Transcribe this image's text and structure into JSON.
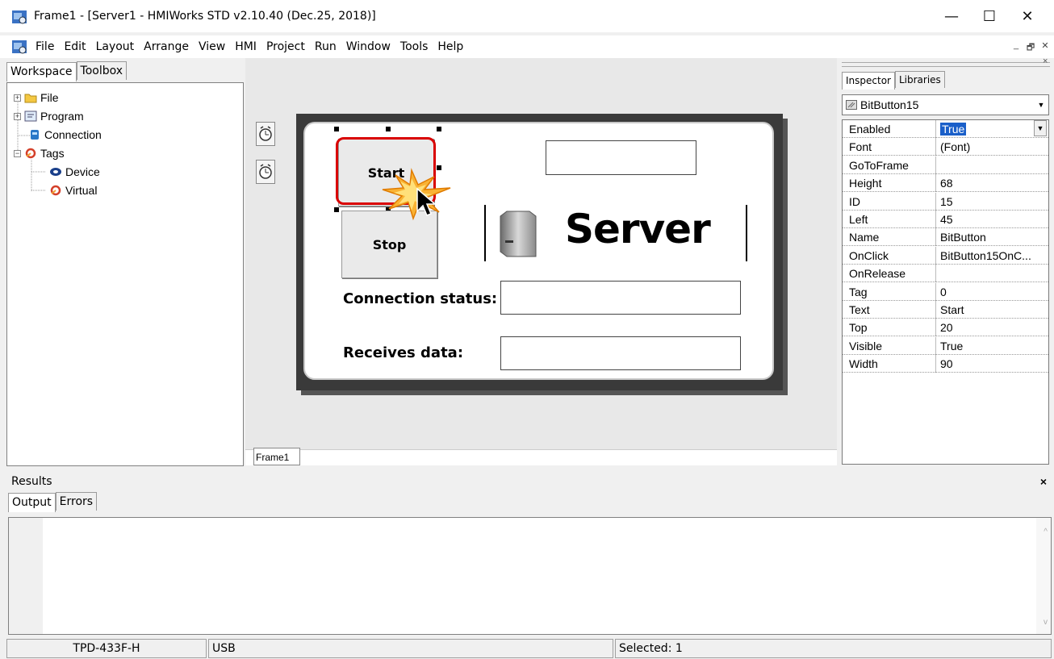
{
  "window": {
    "title": "Frame1 - [Server1 - HMIWorks STD v2.10.40 (Dec.25, 2018)]",
    "controls": {
      "minimize": "—",
      "maximize": "☐",
      "close": "✕"
    }
  },
  "menu": [
    "File",
    "Edit",
    "Layout",
    "Arrange",
    "View",
    "HMI",
    "Project",
    "Run",
    "Window",
    "Tools",
    "Help"
  ],
  "mdi_controls": [
    "_",
    "🗗",
    "✕"
  ],
  "workspace": {
    "tabs": [
      "Workspace",
      "Toolbox"
    ],
    "tree": [
      {
        "label": "File",
        "expander": "+",
        "icon": "folder-icon"
      },
      {
        "label": "Program",
        "expander": "+",
        "icon": "program-icon"
      },
      {
        "label": "Connection",
        "expander": "",
        "icon": "connection-icon"
      },
      {
        "label": "Tags",
        "expander": "−",
        "icon": "tags-icon"
      },
      {
        "label": "Device",
        "expander": "",
        "icon": "device-icon"
      },
      {
        "label": "Virtual",
        "expander": "",
        "icon": "virtual-icon"
      }
    ]
  },
  "design": {
    "frame_tab": "Frame1",
    "start_label": "Start",
    "stop_label": "Stop",
    "server_label": "Server",
    "conn_status_label": "Connection status:",
    "receives_label": "Receives data:"
  },
  "inspector": {
    "tabs": [
      "Inspector",
      "Libraries"
    ],
    "selected_object": "BitButton15",
    "properties": [
      {
        "name": "Enabled",
        "value": "True"
      },
      {
        "name": "Font",
        "value": "(Font)"
      },
      {
        "name": "GoToFrame",
        "value": ""
      },
      {
        "name": "Height",
        "value": "68"
      },
      {
        "name": "ID",
        "value": "15"
      },
      {
        "name": "Left",
        "value": "45"
      },
      {
        "name": "Name",
        "value": "BitButton"
      },
      {
        "name": "OnClick",
        "value": "BitButton15OnC..."
      },
      {
        "name": "OnRelease",
        "value": ""
      },
      {
        "name": "Tag",
        "value": "0"
      },
      {
        "name": "Text",
        "value": "Start"
      },
      {
        "name": "Top",
        "value": "20"
      },
      {
        "name": "Visible",
        "value": "True"
      },
      {
        "name": "Width",
        "value": "90"
      }
    ]
  },
  "results": {
    "title": "Results",
    "close": "×",
    "tabs": [
      "Output",
      "Errors"
    ]
  },
  "status": {
    "device": "TPD-433F-H",
    "port": "USB",
    "selected": "Selected: 1"
  }
}
